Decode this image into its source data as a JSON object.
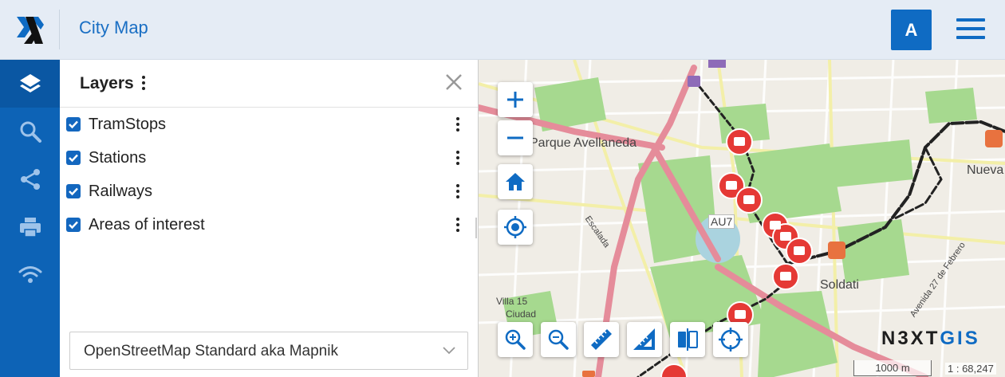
{
  "header": {
    "app_title": "City Map",
    "user_initial": "A"
  },
  "rail": {
    "items": [
      {
        "icon": "layers-icon",
        "active": true
      },
      {
        "icon": "search-icon",
        "active": false
      },
      {
        "icon": "share-icon",
        "active": false
      },
      {
        "icon": "print-icon",
        "active": false
      },
      {
        "icon": "wifi-icon",
        "active": false
      }
    ]
  },
  "panel": {
    "title": "Layers",
    "layers": [
      {
        "label": "TramStops",
        "checked": true
      },
      {
        "label": "Stations",
        "checked": true
      },
      {
        "label": "Railways",
        "checked": true
      },
      {
        "label": "Areas of interest",
        "checked": true
      }
    ],
    "basemap": {
      "selected": "OpenStreetMap Standard aka Mapnik"
    }
  },
  "map": {
    "labels": {
      "parque": "Parque Avellaneda",
      "au7": "AU7",
      "soldati": "Soldati",
      "nueva": "Nueva",
      "escalada": "Escalada",
      "avenida": "Avenida 27 de Febrero",
      "villa": "Villa 15",
      "ciudad": "Ciudad"
    },
    "brand_prefix": "N3XT",
    "brand_suffix": "GIS",
    "scale_label": "1000 m",
    "scale_ratio": "1 : 68,247"
  },
  "colors": {
    "accent": "#0f6bc3",
    "rail_bg": "#0d63b6",
    "header_bg": "#e5ecf5",
    "tram_stop": "#e53935",
    "park": "#9fd688",
    "main_road": "#e58c9a"
  }
}
